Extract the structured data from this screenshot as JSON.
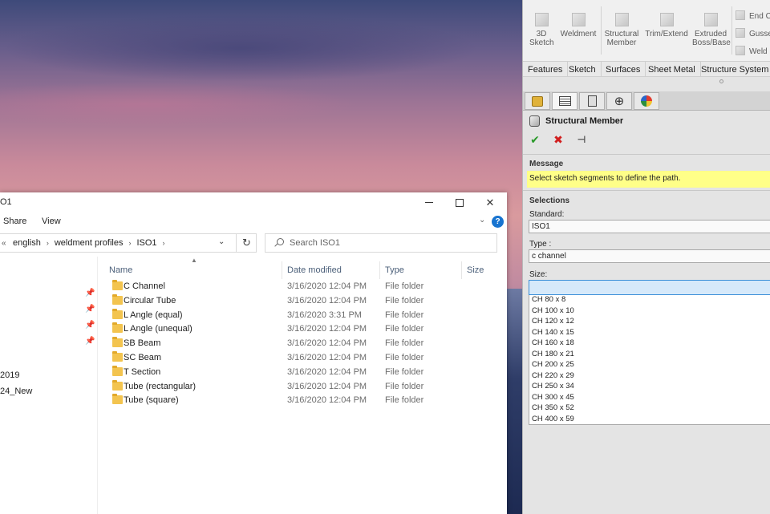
{
  "explorer": {
    "title_fragment": "O1",
    "menu": [
      "Share",
      "View"
    ],
    "help_label": "?",
    "address": {
      "back": "«",
      "crumbs": [
        "english",
        "weldment profiles",
        "ISO1"
      ]
    },
    "search": {
      "placeholder": "Search ISO1"
    },
    "nav_items": [
      "2019",
      "24_New"
    ],
    "columns": {
      "name": "Name",
      "date": "Date modified",
      "type": "Type",
      "size": "Size"
    },
    "files": [
      {
        "name": "C Channel",
        "date": "3/16/2020 12:04 PM",
        "type": "File folder"
      },
      {
        "name": "Circular Tube",
        "date": "3/16/2020 12:04 PM",
        "type": "File folder"
      },
      {
        "name": "L Angle (equal)",
        "date": "3/16/2020 3:31 PM",
        "type": "File folder"
      },
      {
        "name": "L Angle (unequal)",
        "date": "3/16/2020 12:04 PM",
        "type": "File folder"
      },
      {
        "name": "SB Beam",
        "date": "3/16/2020 12:04 PM",
        "type": "File folder"
      },
      {
        "name": "SC Beam",
        "date": "3/16/2020 12:04 PM",
        "type": "File folder"
      },
      {
        "name": "T Section",
        "date": "3/16/2020 12:04 PM",
        "type": "File folder"
      },
      {
        "name": "Tube (rectangular)",
        "date": "3/16/2020 12:04 PM",
        "type": "File folder"
      },
      {
        "name": "Tube (square)",
        "date": "3/16/2020 12:04 PM",
        "type": "File folder"
      }
    ]
  },
  "solidworks": {
    "ribbon": {
      "sketch3d": [
        "3D",
        "Sketch"
      ],
      "weldment": "Weldment",
      "structural": [
        "Structural",
        "Member"
      ],
      "trim": "Trim/Extend",
      "extruded": [
        "Extruded",
        "Boss/Base"
      ],
      "small": [
        "End C",
        "Gusse",
        "Weld"
      ]
    },
    "tabs": [
      "Features",
      "Sketch",
      "Surfaces",
      "Sheet Metal",
      "Structure System"
    ],
    "property_manager": {
      "title": "Structural Member",
      "message_title": "Message",
      "message": "Select sketch segments to define the path.",
      "selections_title": "Selections",
      "standard_label": "Standard:",
      "standard_value": "ISO1",
      "type_label": "Type :",
      "type_value": "c channel",
      "size_label": "Size:",
      "size_options": [
        "CH 80 x 8",
        "CH 100 x 10",
        "CH 120 x 12",
        "CH 140 x 15",
        "CH 160 x 18",
        "CH 180 x 21",
        "CH 200 x 25",
        "CH 220 x 29",
        "CH 250 x 34",
        "CH 300 x 45",
        "CH 350 x 52",
        "CH 400 x 59"
      ]
    }
  },
  "colors": {
    "accent": "#1874d0",
    "message_bg": "#ffff88",
    "folder": "#f3c44f",
    "ok": "#2a9a2a",
    "cancel": "#d11e1e"
  }
}
